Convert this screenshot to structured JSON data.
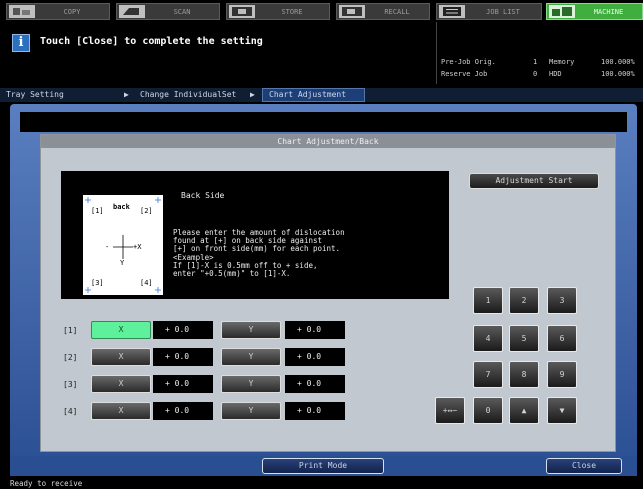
{
  "tabs": [
    {
      "label": "COPY",
      "icon": "copy-icon",
      "active": false
    },
    {
      "label": "SCAN",
      "icon": "scan-icon",
      "active": false
    },
    {
      "label": "STORE",
      "icon": "store-icon",
      "active": false
    },
    {
      "label": "RECALL",
      "icon": "recall-icon",
      "active": false
    },
    {
      "label": "JOB LIST",
      "icon": "job-list-icon",
      "active": false
    },
    {
      "label": "MACHINE",
      "icon": "machine-icon",
      "active": true
    }
  ],
  "message": {
    "icon": "info-icon",
    "text": "Touch [Close] to complete the setting"
  },
  "status": {
    "pre_job_label": "Pre-Job Orig.",
    "pre_job_value": "1",
    "memory_label": "Memory",
    "memory_value": "100.000%",
    "reserve_label": "Reserve Job",
    "reserve_value": "0",
    "hdd_label": "HDD",
    "hdd_value": "100.000%"
  },
  "breadcrumb": {
    "item1": "Tray Setting",
    "item2": "Change IndividualSet",
    "current": "Chart Adjustment"
  },
  "dialog": {
    "title": "Chart Adjustment/Back",
    "instruction_title": "Back Side",
    "instruction_body": "Please enter the amount of dislocation\nfound at [+] on back side against\n[+] on front side(mm) for each point.\n<Example>\nIf [1]-X is 0.5mm off to + side,\nenter \"+0.5(mm)\" to [1]-X.",
    "diagram": {
      "back": "back",
      "p1": "[1]",
      "p2": "[2]",
      "p3": "[3]",
      "p4": "[4]",
      "minus": "-",
      "plus_x": "+X",
      "y": "Y"
    },
    "adjustment_start": "Adjustment Start"
  },
  "points": [
    {
      "label": "[1]",
      "x_label": "X",
      "x_value": "+ 0.0",
      "y_label": "Y",
      "y_value": "+ 0.0",
      "x_selected": true
    },
    {
      "label": "[2]",
      "x_label": "X",
      "x_value": "+ 0.0",
      "y_label": "Y",
      "y_value": "+ 0.0",
      "x_selected": false
    },
    {
      "label": "[3]",
      "x_label": "X",
      "x_value": "+ 0.0",
      "y_label": "Y",
      "y_value": "+ 0.0",
      "x_selected": false
    },
    {
      "label": "[4]",
      "x_label": "X",
      "x_value": "+ 0.0",
      "y_label": "Y",
      "y_value": "+ 0.0",
      "x_selected": false
    }
  ],
  "keypad": {
    "k1": "1",
    "k2": "2",
    "k3": "3",
    "k4": "4",
    "k5": "5",
    "k6": "6",
    "k7": "7",
    "k8": "8",
    "k9": "9",
    "sign": "+↔−",
    "k0": "0",
    "up": "▲",
    "down": "▼"
  },
  "bottom": {
    "print_mode": "Print Mode",
    "close": "Close"
  },
  "footer": {
    "status": "Ready to receive"
  }
}
